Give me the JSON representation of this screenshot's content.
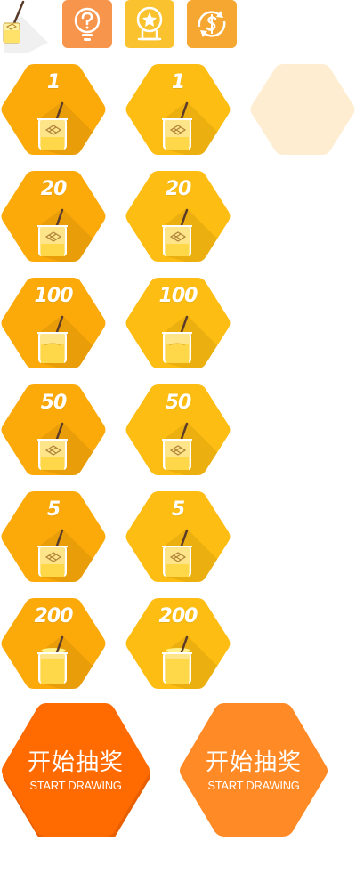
{
  "colors": {
    "hex_orange": "#FBAA0A",
    "hex_yellow": "#FDBD12",
    "hex_faded": "#FEEDD0",
    "btn_red": "#FF6B00",
    "btn_orange": "#FF8A26",
    "icon_help_bg": "#F7954D",
    "icon_award_bg": "#F9C22E",
    "icon_coin_bg": "#F5A731"
  },
  "top_icons": [
    {
      "name": "honey-jar-icon"
    },
    {
      "name": "lightbulb-icon"
    },
    {
      "name": "award-medal-icon"
    },
    {
      "name": "coin-swap-icon"
    }
  ],
  "prizes": [
    {
      "label": "1",
      "jar": "low"
    },
    {
      "label": "20",
      "jar": "low"
    },
    {
      "label": "100",
      "jar": "mid"
    },
    {
      "label": "50",
      "jar": "low"
    },
    {
      "label": "5",
      "jar": "low"
    },
    {
      "label": "200",
      "jar": "full"
    }
  ],
  "draw_buttons": [
    {
      "cn": "开始抽奖",
      "en": "START DRAWING"
    },
    {
      "cn": "开始抽奖",
      "en": "START DRAWING"
    }
  ]
}
